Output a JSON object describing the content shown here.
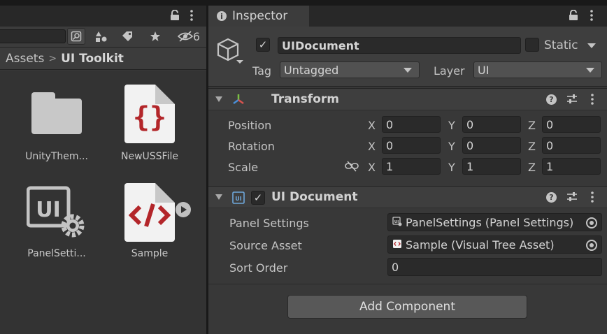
{
  "project": {
    "hidden_count": "6",
    "breadcrumb": {
      "root": "Assets",
      "separator": ">",
      "current": "UI Toolkit"
    },
    "assets": [
      {
        "name": "UnityThem...",
        "kind": "folder"
      },
      {
        "name": "NewUSSFile",
        "kind": "uss"
      },
      {
        "name": "PanelSetti...",
        "kind": "panel-settings"
      },
      {
        "name": "Sample",
        "kind": "uxml"
      }
    ],
    "icons": {
      "lock": "lock-icon",
      "menu": "kebab-menu-icon",
      "search_type": "search-by-type-icon",
      "label": "label-icon",
      "favorite": "star-icon",
      "hidden": "eye-hidden-icon"
    }
  },
  "inspector": {
    "tab_title": "Inspector",
    "object": {
      "name": "UIDocument",
      "active": true,
      "static_label": "Static",
      "static": false,
      "tag_label": "Tag",
      "tag_value": "Untagged",
      "layer_label": "Layer",
      "layer_value": "UI"
    },
    "transform": {
      "title": "Transform",
      "rows": [
        {
          "label": "Position",
          "x": "0",
          "y": "0",
          "z": "0"
        },
        {
          "label": "Rotation",
          "x": "0",
          "y": "0",
          "z": "0"
        },
        {
          "label": "Scale",
          "x": "1",
          "y": "1",
          "z": "1"
        }
      ],
      "axes": {
        "x": "X",
        "y": "Y",
        "z": "Z"
      }
    },
    "ui_document": {
      "title": "UI Document",
      "enabled": true,
      "panel_settings_label": "Panel Settings",
      "panel_settings_value": "PanelSettings (Panel Settings)",
      "source_asset_label": "Source Asset",
      "source_asset_value": "Sample (Visual Tree Asset)",
      "sort_order_label": "Sort Order",
      "sort_order_value": "0"
    },
    "add_component_label": "Add Component"
  },
  "colors": {
    "panel_bg": "#383838",
    "field_bg": "#2a2a2a",
    "uss_red": "#b3262a",
    "text": "#c4c4c4"
  }
}
